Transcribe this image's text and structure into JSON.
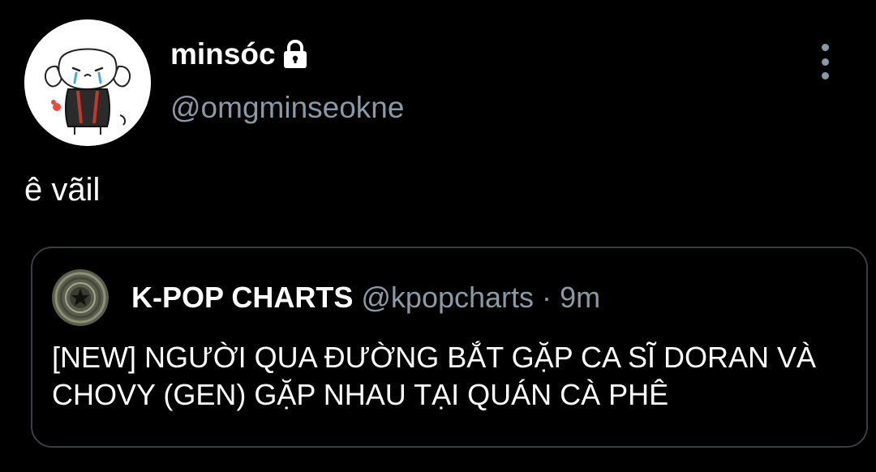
{
  "author": {
    "display_name": "minsóc",
    "handle": "@omgminseokne",
    "avatar_icon": "cartoon-dog-avatar",
    "protected_icon": "lock-icon"
  },
  "tweet": {
    "text": "ê vãil"
  },
  "menu": {
    "icon": "more-vertical-icon"
  },
  "quoted_tweet": {
    "display_name": "K-POP CHARTS",
    "handle": "@kpopcharts",
    "separator": "·",
    "time": "9m",
    "avatar_icon": "star-badge-avatar",
    "text": "[NEW] NGƯỜI QUA ĐƯỜNG BẮT GẶP CA SĨ DORAN VÀ CHOVY (GEN) GẶP NHAU TẠI QUÁN CÀ PHÊ"
  },
  "colors": {
    "background": "#000000",
    "primary_text": "#ffffff",
    "secondary_text": "#8b98a5",
    "card_border": "#3a3d41"
  }
}
